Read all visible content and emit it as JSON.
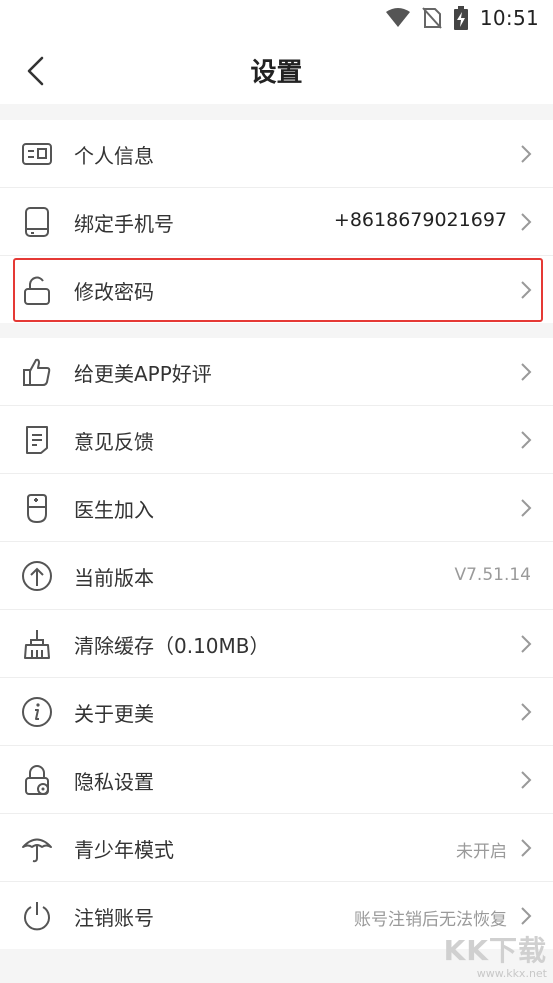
{
  "status_bar": {
    "time": "10:51"
  },
  "header": {
    "title": "设置"
  },
  "group1": [
    {
      "label": "个人信息",
      "value": "",
      "icon": "id-card-icon"
    },
    {
      "label": "绑定手机号",
      "value": "+8618679021697",
      "icon": "phone-icon"
    },
    {
      "label": "修改密码",
      "value": "",
      "icon": "lock-icon"
    }
  ],
  "group2": [
    {
      "label": "给更美APP好评",
      "value": "",
      "icon": "thumbs-up-icon"
    },
    {
      "label": "意见反馈",
      "value": "",
      "icon": "document-icon"
    },
    {
      "label": "医生加入",
      "value": "",
      "icon": "doctor-icon"
    },
    {
      "label": "当前版本",
      "value": "V7.51.14",
      "icon": "arrow-up-circle-icon"
    },
    {
      "label": "清除缓存（0.10MB）",
      "value": "",
      "icon": "broom-icon"
    },
    {
      "label": "关于更美",
      "value": "",
      "icon": "info-icon"
    },
    {
      "label": "隐私设置",
      "value": "",
      "icon": "privacy-lock-icon"
    },
    {
      "label": "青少年模式",
      "value": "未开启",
      "icon": "umbrella-icon"
    },
    {
      "label": "注销账号",
      "value": "账号注销后无法恢复",
      "icon": "power-icon"
    }
  ],
  "watermark": {
    "logo": "KK下载",
    "url": "www.kkx.net"
  },
  "colors": {
    "highlight": "#e53935",
    "background": "#f5f5f5",
    "icon": "#555555"
  }
}
